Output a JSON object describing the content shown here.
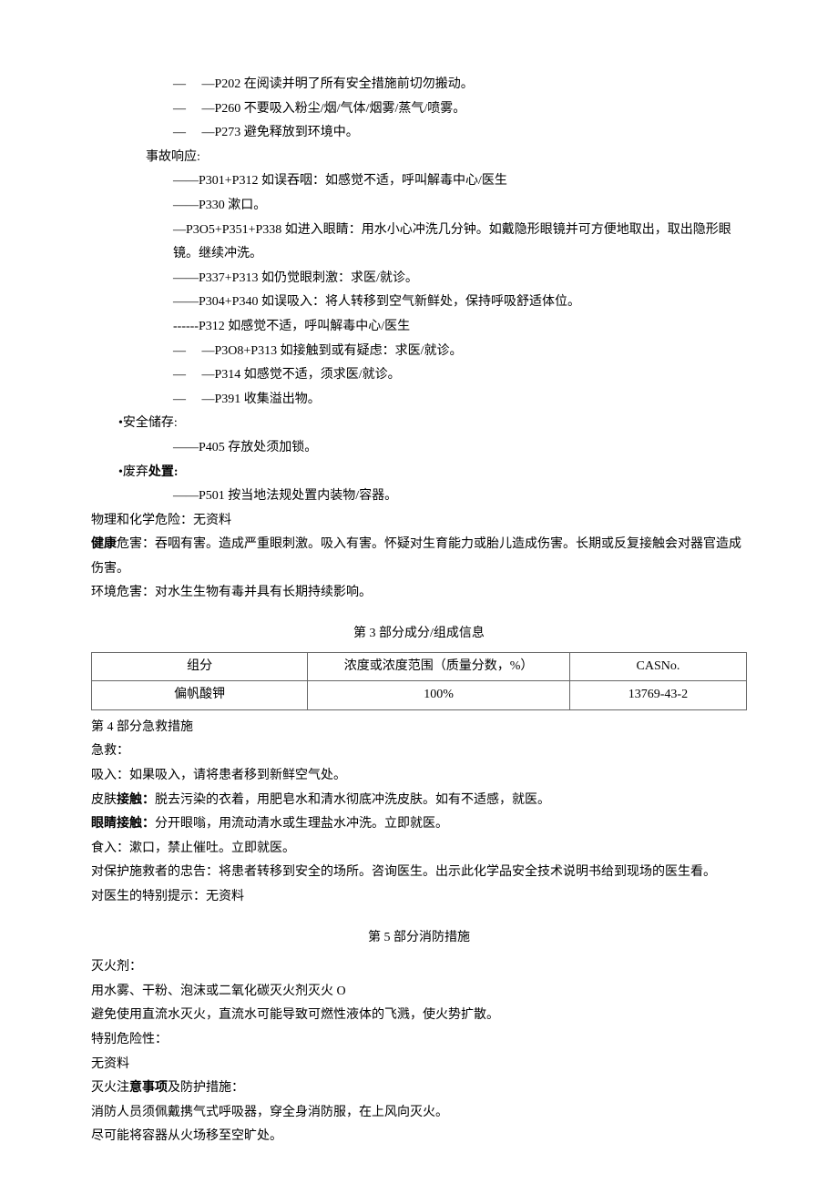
{
  "lines": {
    "l1": "— 　—P202 在阅读并明了所有安全措施前切勿搬动。",
    "l2": "— 　—P260 不要吸入粉尘/烟/气体/烟雾/蒸气/喷雾。",
    "l3": "— 　—P273 避免释放到环境中。",
    "l4": "事故响应:",
    "l5": "——P301+P312 如误吞咽：如感觉不适，呼叫解毒中心/医生",
    "l6": "——P330 漱口。",
    "l7": "—P3O5+P351+P338 如进入眼睛：用水小心冲洗几分钟。如戴隐形眼镜并可方便地取出，取出隐形眼镜。继续冲洗。",
    "l8": "——P337+P313 如仍觉眼刺激：求医/就诊。",
    "l9": "——P304+P340 如误吸入：将人转移到空气新鲜处，保持呼吸舒适体位。",
    "l10": "------P312 如感觉不适，呼叫解毒中心/医生",
    "l11": "— 　—P3O8+P313 如接触到或有疑虑：求医/就诊。",
    "l12": "— 　—P314 如感觉不适，须求医/就诊。",
    "l13": "— 　—P391 收集溢出物。",
    "l14": "•安全储存:",
    "l15": "——P405 存放处须加锁。",
    "l16_a": "•废弃",
    "l16_b": "处置:",
    "l17": "——P501 按当地法规处置内装物/容器。",
    "l18": "物理和化学危险：无资料",
    "l19_a": "健康",
    "l19_b": "危害：吞咽有害。造成严重眼刺激。吸入有害。怀疑对生育能力或胎儿造成伤害。长期或反复接触会对器官造成伤害。",
    "l20": "环境危害：对水生生物有毒并具有长期持续影响。"
  },
  "section3": {
    "title": "第 3 部分成分/组成信息",
    "header": {
      "c1": "组分",
      "c2": "浓度或浓度范围（质量分数，%）",
      "c3": "CASNo."
    },
    "row": {
      "c1": "偏帆酸钾",
      "c2": "100%",
      "c3": "13769-43-2"
    }
  },
  "section4": {
    "heading": "第 4 部分急救措施",
    "p1": "急救：",
    "p2": "吸入：如果吸入，请将患者移到新鲜空气处。",
    "p3_a": "皮肤",
    "p3_b": "接触：",
    "p3_c": "脱去污染的衣着，用肥皂水和清水彻底冲洗皮肤。如有不适感，就医。",
    "p4_a": "眼睛接触：",
    "p4_b": "分开眼嗡，用流动清水或生理盐水冲洗。立即就医。",
    "p5": "食入：漱口，禁止催吐。立即就医。",
    "p6": "对保护施救者的忠告：将患者转移到安全的场所。咨询医生。出示此化学品安全技术说明书给到现场的医生看。",
    "p7": "对医生的特别提示：无资料"
  },
  "section5": {
    "title": "第 5 部分消防措施",
    "p1": "灭火剂：",
    "p2": "用水雾、干粉、泡沫或二氧化碳灭火剂灭火 O",
    "p3": "避免使用直流水灭火，直流水可能导致可燃性液体的飞溅，使火势扩散。",
    "p4": "特别危险性：",
    "p5": "无资料",
    "p6_a": "灭火注",
    "p6_b": "意事项",
    "p6_c": "及防护措施：",
    "p7": "消防人员须佩戴携气式呼吸器，穿全身消防服，在上风向灭火。",
    "p8": "尽可能将容器从火场移至空旷处。"
  }
}
